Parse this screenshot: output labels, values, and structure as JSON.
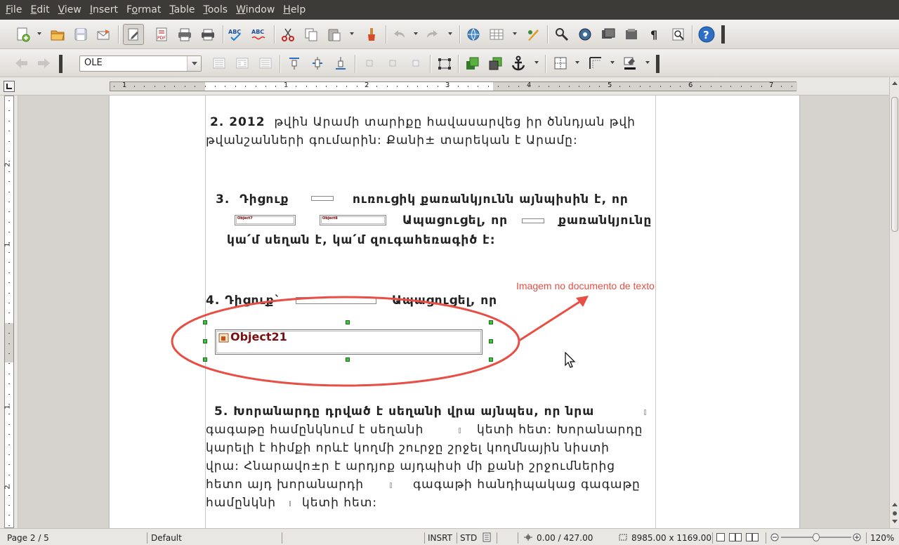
{
  "menu": {
    "items": [
      {
        "pre": "",
        "ul": "F",
        "post": "ile"
      },
      {
        "pre": "",
        "ul": "E",
        "post": "dit"
      },
      {
        "pre": "",
        "ul": "V",
        "post": "iew"
      },
      {
        "pre": "",
        "ul": "I",
        "post": "nsert"
      },
      {
        "pre": "F",
        "ul": "o",
        "post": "rmat"
      },
      {
        "pre": "",
        "ul": "T",
        "post": "able"
      },
      {
        "pre": "",
        "ul": "T",
        "post": "ools"
      },
      {
        "pre": "",
        "ul": "W",
        "post": "indow"
      },
      {
        "pre": "",
        "ul": "H",
        "post": "elp"
      }
    ]
  },
  "toolbar2": {
    "object_name_value": "OLE"
  },
  "ruler": {
    "h_labels": [
      "1",
      "1",
      "2",
      "3",
      "4",
      "5",
      "6",
      "7"
    ],
    "v_labels": [
      "2",
      "1",
      "1",
      "2"
    ]
  },
  "doc": {
    "p2_num": "2. 2012",
    "p2_line1": "թվին Արամի տարիքը հավասարվեց  իր ծննդյան թվի",
    "p2_line2": "թվանշանների գումարին: Քանի± տարեկան է Արամը:",
    "p3_num": "3.",
    "p3_line1a": "Դիցուք",
    "p3_line1b": "ուռուցիկ  քառանկյունն  այնպիսին  է,  որ",
    "p3_obj_a": "Object7",
    "p3_obj_b": "Object8",
    "p3_line2": "Ապացուցել, որ",
    "p3_line2b": "քառանկյունը",
    "p3_line3": "կա՛մ սեղան է, կա՛մ զուգահեռագիծ է:",
    "p4_line1a": "4. Դիցուք`",
    "p4_line1b": "Ապացուցել, որ",
    "p4_object": "Object21",
    "p5_line1": "5. Խորանարդը դրված է սեղանի վրա այնպես, որ նրա",
    "p5_line2": "գագաթը համընկնում  է սեղանի",
    "p5_line2b": "կետի հետ: Խորանարդը",
    "p5_line3": "կարելի  է հիմքի որևէ կողմի շուրջը շրջել կողմնային նիստի",
    "p5_line4": "վրա: Հնարավո±ր է արդյոք այդպիսի մի քանի շրջումներից",
    "p5_line5a": "հետո այդ խորանարդի",
    "p5_line5b": "գագաթի հանդիպակաց գագաթը",
    "p5_line6a": "համընկնի",
    "p5_line6b": "կետի հետ:"
  },
  "annotation": {
    "text": "Imagem no documento de texto",
    "color": "#e94e45"
  },
  "status": {
    "page": "Page 2 / 5",
    "style": "Default",
    "insert_mode": "INSRT",
    "selection_mode": "STD",
    "position": "0.00 / 427.00",
    "size": "8985.00 x 1169.00",
    "zoom": "120%"
  }
}
